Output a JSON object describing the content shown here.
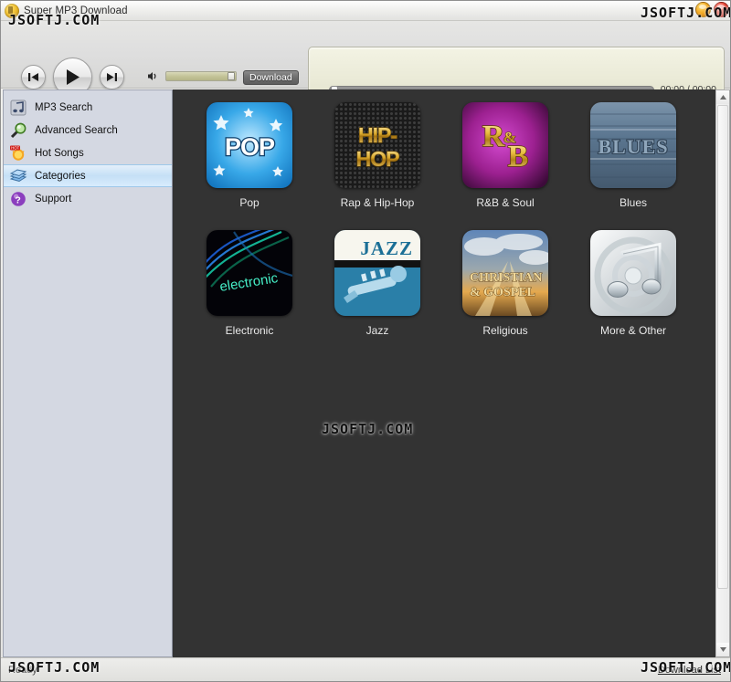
{
  "window": {
    "title": "Super MP3 Download",
    "icon": "app-icon",
    "buttons": [
      {
        "name": "minimize",
        "label": ""
      },
      {
        "name": "close",
        "label": ""
      }
    ]
  },
  "toolbar": {
    "previous_label": "Previous",
    "play_label": "Play",
    "next_label": "Next",
    "volume_icon": "speaker-icon",
    "volume_value": 95,
    "download_label": "Download"
  },
  "player": {
    "seek_value": 0,
    "time_display": "00:00 / 00:00"
  },
  "sidebar": {
    "items": [
      {
        "label": "MP3 Search",
        "icon": "music-note-icon",
        "selected": false
      },
      {
        "label": "Advanced Search",
        "icon": "magnifier-icon",
        "selected": false
      },
      {
        "label": "Hot Songs",
        "icon": "hot-sun-icon",
        "selected": false
      },
      {
        "label": "Categories",
        "icon": "books-icon",
        "selected": true
      },
      {
        "label": "Support",
        "icon": "question-ball-icon",
        "selected": false
      }
    ]
  },
  "categories": {
    "tiles": [
      {
        "label": "Pop",
        "art": "pop"
      },
      {
        "label": "Rap & Hip-Hop",
        "art": "hiphop"
      },
      {
        "label": "R&B & Soul",
        "art": "rnb"
      },
      {
        "label": "Blues",
        "art": "blues"
      },
      {
        "label": "Electronic",
        "art": "electronic"
      },
      {
        "label": "Jazz",
        "art": "jazz"
      },
      {
        "label": "Religious",
        "art": "religious"
      },
      {
        "label": "More & Other",
        "art": "more"
      }
    ]
  },
  "statusbar": {
    "status": "Ready",
    "download_list_label": "Download List"
  },
  "watermarks": {
    "text": "JSOFTJ.COM"
  },
  "colors": {
    "content_bg": "#333333",
    "sidebar_bg": "#d4d8e2",
    "selected_item": "#c5e0f6",
    "display_bg": "#ebebd8",
    "accent_close": "#e03a2a",
    "accent_minimize": "#f2a61c"
  }
}
